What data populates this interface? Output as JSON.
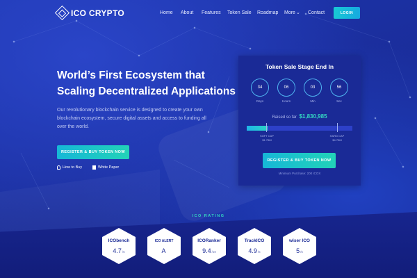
{
  "header": {
    "logo_text": "ICO CRYPTO",
    "nav": [
      "Home",
      "About",
      "Features",
      "Token Sale",
      "Roadmap",
      "More",
      "Contact"
    ],
    "more_caret": "⌄",
    "login_label": "LOGIN"
  },
  "hero": {
    "title_line1": "World’s First Ecosystem that",
    "title_line2": "Scaling Decentralized Applications",
    "description": "Our revolutionary blockchain service is designed to create your own blockchain ecosystem, secure digital assets and access to funding all over the world.",
    "cta_label": "REGISTER & BUY TOKEN NOW",
    "how_to_buy": "How to Buy",
    "white_paper": "White Paper"
  },
  "token_sale": {
    "title": "Token Sale Stage End In",
    "countdown": [
      {
        "value": "34",
        "label": "Days"
      },
      {
        "value": "06",
        "label": "Hours"
      },
      {
        "value": "03",
        "label": "Min"
      },
      {
        "value": "56",
        "label": "Sec"
      }
    ],
    "raised_label": "Raised so far",
    "raised_amount": "$1,830,985",
    "progress_fraction": 0.2,
    "soft_cap_label": "SOFT CAP",
    "soft_cap_value": "$1.75M",
    "hard_cap_label": "HARD CAP",
    "hard_cap_value": "$4.75M",
    "cta_label": "REGISTER & BUY TOKEN NOW",
    "min_purchase": "Minimum Purchase: 200 ICOX"
  },
  "rating": {
    "title": "ICO RATING",
    "items": [
      {
        "logo": "ICObench",
        "score": "4.7",
        "out_of": "/5"
      },
      {
        "logo": "ICO ALERT",
        "score": "A",
        "out_of": ""
      },
      {
        "logo": "ICORanker",
        "score": "9.4",
        "out_of": "/10"
      },
      {
        "logo": "TrackICO",
        "score": "4.9",
        "out_of": "/5"
      },
      {
        "logo": "wiser ICO",
        "score": "5",
        "out_of": "/5"
      }
    ]
  },
  "colors": {
    "background": "#1b2fa3",
    "accent": "#22d3b8",
    "panel": "#1a2a96"
  }
}
